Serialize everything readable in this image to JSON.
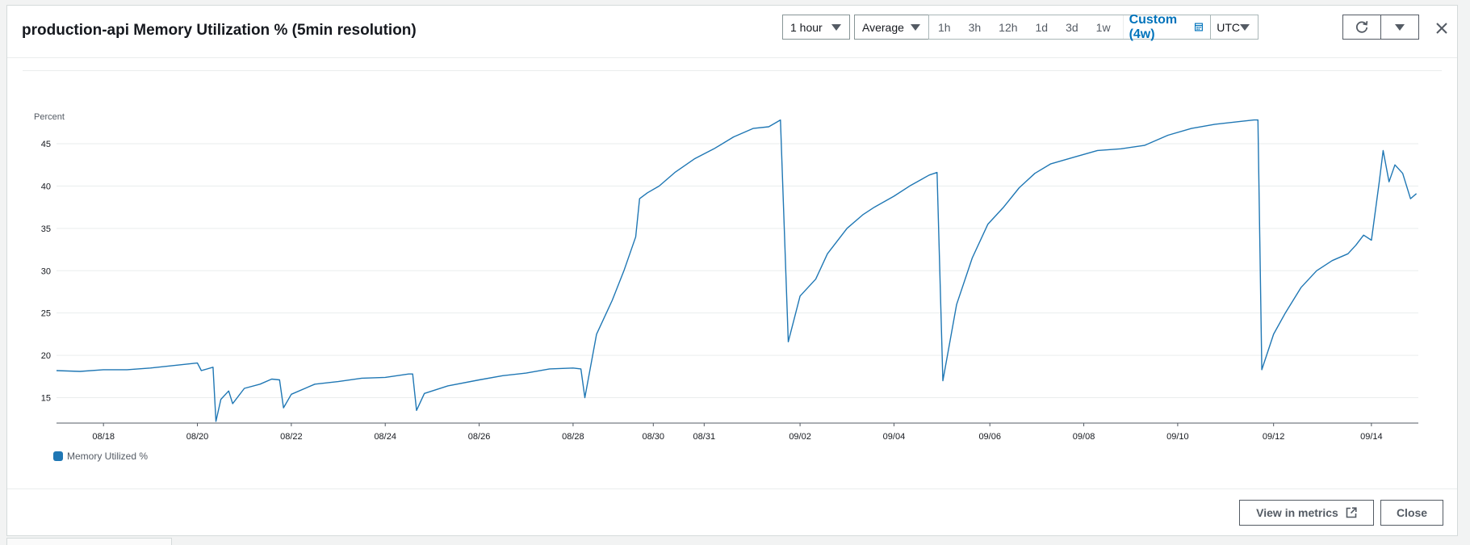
{
  "header": {
    "title": "production-api Memory Utilization % (5min resolution)",
    "period_select": "1 hour",
    "stat_select": "Average",
    "ranges": [
      "1h",
      "3h",
      "12h",
      "1d",
      "3d",
      "1w"
    ],
    "custom_range": "Custom (4w)",
    "timezone": "UTC",
    "icons": {
      "refresh": "refresh-icon",
      "actions": "caret-down-icon",
      "close": "close-icon",
      "calendar": "calendar-icon"
    }
  },
  "footer": {
    "view_in_metrics": "View in metrics",
    "close": "Close"
  },
  "colors": {
    "series": "#1f77b4",
    "accent": "#0073bb"
  },
  "chart_data": {
    "type": "line",
    "ylabel": "Percent",
    "xlabel": "",
    "ylim": [
      12,
      47
    ],
    "yticks": [
      15,
      20,
      25,
      30,
      35,
      40,
      45
    ],
    "xlim": [
      "2024-08-17",
      "2024-09-14"
    ],
    "xticks": [
      {
        "label": "08/18",
        "x": "2024-08-18"
      },
      {
        "label": "08/20",
        "x": "2024-08-20"
      },
      {
        "label": "08/22",
        "x": "2024-08-22"
      },
      {
        "label": "08/24",
        "x": "2024-08-24"
      },
      {
        "label": "08/26",
        "x": "2024-08-26"
      },
      {
        "label": "08/28",
        "x": "2024-08-28"
      },
      {
        "label": "08/30",
        "x": "2024-08-29 17:00"
      },
      {
        "label": "08/31",
        "x": "2024-08-30 19:00"
      },
      {
        "label": "09/02",
        "x": "2024-09-01 20:00"
      },
      {
        "label": "09/04",
        "x": "2024-09-03 20:00"
      },
      {
        "label": "09/06",
        "x": "2024-09-05 21:00"
      },
      {
        "label": "09/08",
        "x": "2024-09-07 21:00"
      },
      {
        "label": "09/10",
        "x": "2024-09-09 21:00"
      },
      {
        "label": "09/12",
        "x": "2024-09-11 22:00"
      },
      {
        "label": "09/14",
        "x": "2024-09-14"
      }
    ],
    "grid": "horizontal",
    "legend": "bottom-left",
    "series": [
      {
        "name": "Memory Utilized %",
        "points": [
          [
            "2024-08-17 00:00",
            18.2
          ],
          [
            "2024-08-17 12:00",
            18.1
          ],
          [
            "2024-08-18 00:00",
            18.3
          ],
          [
            "2024-08-18 12:00",
            18.3
          ],
          [
            "2024-08-19 00:00",
            18.5
          ],
          [
            "2024-08-19 12:00",
            18.8
          ],
          [
            "2024-08-20 00:00",
            19.1
          ],
          [
            "2024-08-20 02:00",
            18.2
          ],
          [
            "2024-08-20 08:00",
            18.6
          ],
          [
            "2024-08-20 09:30",
            12.2
          ],
          [
            "2024-08-20 12:00",
            14.8
          ],
          [
            "2024-08-20 16:00",
            15.8
          ],
          [
            "2024-08-20 18:00",
            14.3
          ],
          [
            "2024-08-21 00:00",
            16.1
          ],
          [
            "2024-08-21 08:00",
            16.6
          ],
          [
            "2024-08-21 14:00",
            17.2
          ],
          [
            "2024-08-21 18:00",
            17.1
          ],
          [
            "2024-08-21 20:00",
            13.8
          ],
          [
            "2024-08-22 00:00",
            15.4
          ],
          [
            "2024-08-22 12:00",
            16.6
          ],
          [
            "2024-08-23 00:00",
            16.9
          ],
          [
            "2024-08-23 12:00",
            17.3
          ],
          [
            "2024-08-24 00:00",
            17.4
          ],
          [
            "2024-08-24 12:00",
            17.8
          ],
          [
            "2024-08-24 14:00",
            17.8
          ],
          [
            "2024-08-24 16:00",
            13.5
          ],
          [
            "2024-08-24 20:00",
            15.5
          ],
          [
            "2024-08-25 08:00",
            16.4
          ],
          [
            "2024-08-26 00:00",
            17.1
          ],
          [
            "2024-08-26 12:00",
            17.6
          ],
          [
            "2024-08-27 00:00",
            17.9
          ],
          [
            "2024-08-27 12:00",
            18.4
          ],
          [
            "2024-08-28 00:00",
            18.5
          ],
          [
            "2024-08-28 04:00",
            18.4
          ],
          [
            "2024-08-28 06:00",
            15.0
          ],
          [
            "2024-08-28 12:00",
            22.5
          ],
          [
            "2024-08-28 20:00",
            26.5
          ],
          [
            "2024-08-29 02:00",
            30.0
          ],
          [
            "2024-08-29 08:00",
            34.0
          ],
          [
            "2024-08-29 10:00",
            38.5
          ],
          [
            "2024-08-29 14:00",
            39.2
          ],
          [
            "2024-08-29 20:00",
            40.0
          ],
          [
            "2024-08-30 04:00",
            41.6
          ],
          [
            "2024-08-30 14:00",
            43.2
          ],
          [
            "2024-08-31 00:00",
            44.4
          ],
          [
            "2024-08-31 10:00",
            45.8
          ],
          [
            "2024-08-31 20:00",
            46.8
          ],
          [
            "2024-09-01 04:00",
            47.0
          ],
          [
            "2024-09-01 10:00",
            47.8
          ],
          [
            "2024-09-01 14:00",
            21.6
          ],
          [
            "2024-09-01 20:00",
            27.0
          ],
          [
            "2024-09-02 04:00",
            29.0
          ],
          [
            "2024-09-02 10:00",
            32.0
          ],
          [
            "2024-09-02 20:00",
            35.0
          ],
          [
            "2024-09-03 04:00",
            36.6
          ],
          [
            "2024-09-03 10:00",
            37.5
          ],
          [
            "2024-09-03 20:00",
            38.8
          ],
          [
            "2024-09-04 04:00",
            40.0
          ],
          [
            "2024-09-04 14:00",
            41.3
          ],
          [
            "2024-09-04 18:00",
            41.6
          ],
          [
            "2024-09-04 21:00",
            17.0
          ],
          [
            "2024-09-05 04:00",
            26.0
          ],
          [
            "2024-09-05 12:00",
            31.5
          ],
          [
            "2024-09-05 20:00",
            35.5
          ],
          [
            "2024-09-06 04:00",
            37.5
          ],
          [
            "2024-09-06 12:00",
            39.8
          ],
          [
            "2024-09-06 20:00",
            41.5
          ],
          [
            "2024-09-07 04:00",
            42.6
          ],
          [
            "2024-09-07 16:00",
            43.4
          ],
          [
            "2024-09-08 04:00",
            44.2
          ],
          [
            "2024-09-08 16:00",
            44.4
          ],
          [
            "2024-09-09 04:00",
            44.8
          ],
          [
            "2024-09-09 16:00",
            46.0
          ],
          [
            "2024-09-10 04:00",
            46.8
          ],
          [
            "2024-09-10 16:00",
            47.3
          ],
          [
            "2024-09-11 04:00",
            47.6
          ],
          [
            "2024-09-11 12:00",
            47.8
          ],
          [
            "2024-09-11 14:00",
            47.8
          ],
          [
            "2024-09-11 16:00",
            18.3
          ],
          [
            "2024-09-11 22:00",
            22.5
          ],
          [
            "2024-09-12 04:00",
            25.0
          ],
          [
            "2024-09-12 12:00",
            28.0
          ],
          [
            "2024-09-12 20:00",
            30.0
          ],
          [
            "2024-09-13 04:00",
            31.2
          ],
          [
            "2024-09-13 12:00",
            32.0
          ],
          [
            "2024-09-13 16:00",
            33.0
          ],
          [
            "2024-09-13 20:00",
            34.2
          ],
          [
            "2024-09-14 00:00",
            33.6
          ],
          [
            "2024-09-14 04:00",
            40.5
          ],
          [
            "2024-09-14 06:00",
            44.2
          ],
          [
            "2024-09-14 09:00",
            40.5
          ],
          [
            "2024-09-14 12:00",
            42.5
          ],
          [
            "2024-09-14 16:00",
            41.5
          ],
          [
            "2024-09-14 20:00",
            38.5
          ],
          [
            "2024-09-14 23:00",
            39.1
          ]
        ]
      }
    ]
  }
}
